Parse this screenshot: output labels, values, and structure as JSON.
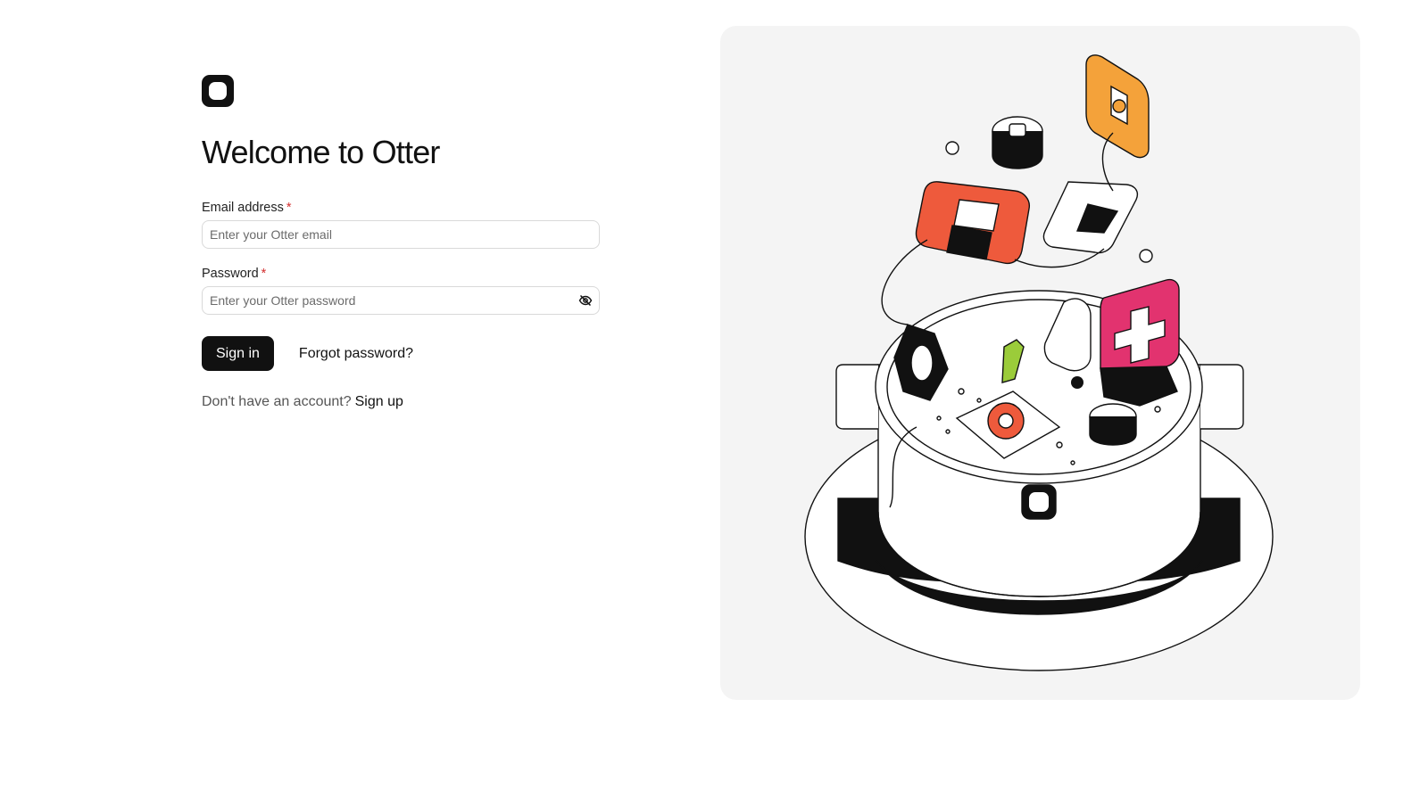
{
  "app": {
    "title": "Welcome to Otter"
  },
  "form": {
    "email": {
      "label": "Email address",
      "required_mark": "*",
      "placeholder": "Enter your Otter email",
      "value": ""
    },
    "password": {
      "label": "Password",
      "required_mark": "*",
      "placeholder": "Enter your Otter password",
      "value": "",
      "toggle_icon": "eye-off-icon"
    },
    "signin_label": "Sign in",
    "forgot_label": "Forgot password?"
  },
  "signup": {
    "prompt": "Don't have an account?",
    "link_label": "Sign up"
  },
  "colors": {
    "primary": "#111111",
    "required": "#d32f2f",
    "panel_bg": "#f4f4f4",
    "accent_orange": "#f4a23a",
    "accent_red": "#ee5a3c",
    "accent_pink": "#e2336f",
    "accent_green": "#9bcc3a"
  }
}
